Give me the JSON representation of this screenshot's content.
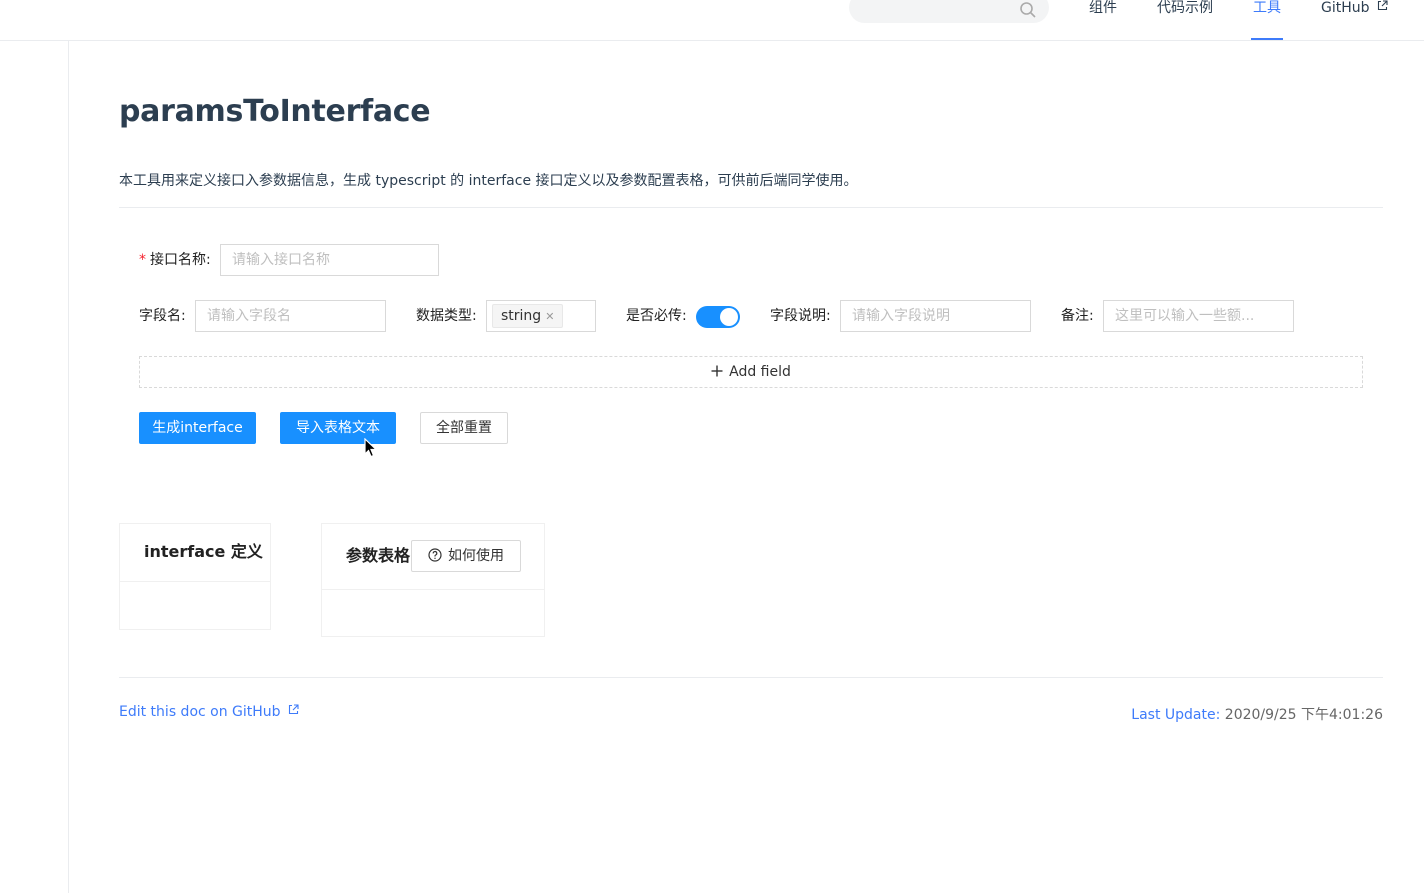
{
  "nav": {
    "search_placeholder": "",
    "items": [
      {
        "label": "组件"
      },
      {
        "label": "代码示例"
      },
      {
        "label": "工具"
      },
      {
        "label": "GitHub"
      }
    ],
    "active_color": "#3e7bfa"
  },
  "page": {
    "title": "paramsToInterface",
    "description": "本工具用来定义接口入参数据信息，生成 typescript 的 interface 接口定义以及参数配置表格，可供前后端同学使用。"
  },
  "form": {
    "interface_name_label": "接口名称:",
    "interface_name_required_mark": "*",
    "interface_name_placeholder": "请输入接口名称",
    "field_name_label": "字段名:",
    "field_name_placeholder": "请输入字段名",
    "data_type_label": "数据类型:",
    "data_type_value": "string",
    "required_label": "是否必传:",
    "required_on": true,
    "field_desc_label": "字段说明:",
    "field_desc_placeholder": "请输入字段说明",
    "remark_label": "备注:",
    "remark_placeholder": "这里可以输入一些额...",
    "add_field_label": "Add field"
  },
  "actions": {
    "generate_label": "生成interface",
    "import_label": "导入表格文本",
    "reset_label": "全部重置"
  },
  "cards": {
    "interface_title": "interface 定义",
    "table_title": "参数表格",
    "how_to_use_label": "如何使用"
  },
  "footer": {
    "edit_link": "Edit this doc on GitHub",
    "last_update_label": "Last Update:",
    "last_update_value": "2020/9/25 下午4:01:26"
  },
  "colors": {
    "primary": "#1890ff",
    "link": "#3e7bfa"
  }
}
